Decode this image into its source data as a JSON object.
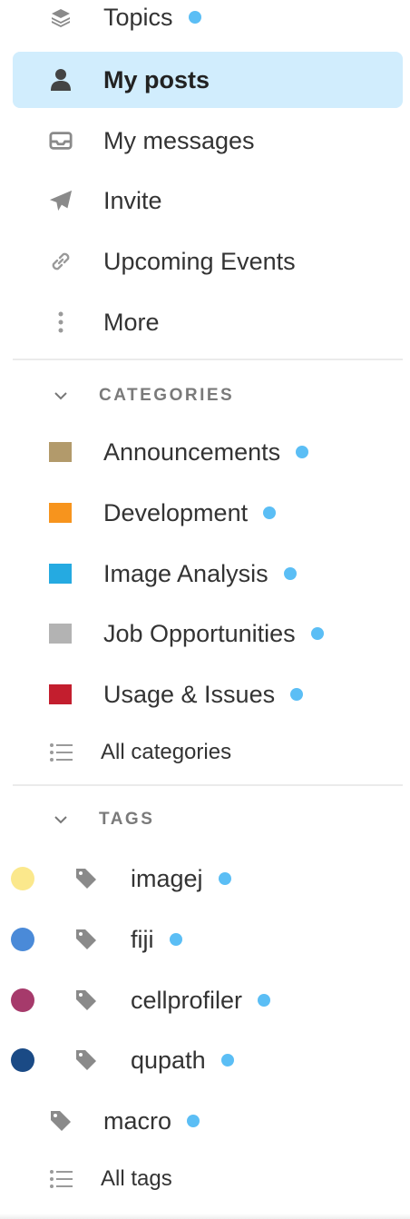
{
  "nav": {
    "topics": {
      "label": "Topics",
      "icon": "layers-icon",
      "has_dot": true
    },
    "my_posts": {
      "label": "My posts",
      "icon": "user-icon",
      "active": true
    },
    "my_messages": {
      "label": "My messages",
      "icon": "inbox-icon"
    },
    "invite": {
      "label": "Invite",
      "icon": "paper-plane-icon"
    },
    "upcoming_events": {
      "label": "Upcoming Events",
      "icon": "link-icon"
    },
    "more": {
      "label": "More",
      "icon": "vertical-dots-icon"
    }
  },
  "categories": {
    "title": "CATEGORIES",
    "items": [
      {
        "label": "Announcements",
        "color": "#b29a6b",
        "has_dot": true
      },
      {
        "label": "Development",
        "color": "#f7941d",
        "has_dot": true
      },
      {
        "label": "Image Analysis",
        "color": "#25aae1",
        "has_dot": true
      },
      {
        "label": "Job Opportunities",
        "color": "#b3b3b3",
        "has_dot": true
      },
      {
        "label": "Usage & Issues",
        "color": "#c31e2e",
        "has_dot": true
      }
    ],
    "all_label": "All categories"
  },
  "tags": {
    "title": "TAGS",
    "items": [
      {
        "label": "imagej",
        "color": "#fbe88c",
        "has_dot": true
      },
      {
        "label": "fiji",
        "color": "#4a8ad8",
        "has_dot": true
      },
      {
        "label": "cellprofiler",
        "color": "#a63a6b",
        "has_dot": true
      },
      {
        "label": "qupath",
        "color": "#1a4a85",
        "has_dot": true
      },
      {
        "label": "macro",
        "color": null,
        "has_dot": true
      }
    ],
    "all_label": "All tags"
  },
  "colors": {
    "active_bg": "#d1edfd",
    "unread_dot": "#5bbef5",
    "icon_grey": "#8a8a8a"
  }
}
